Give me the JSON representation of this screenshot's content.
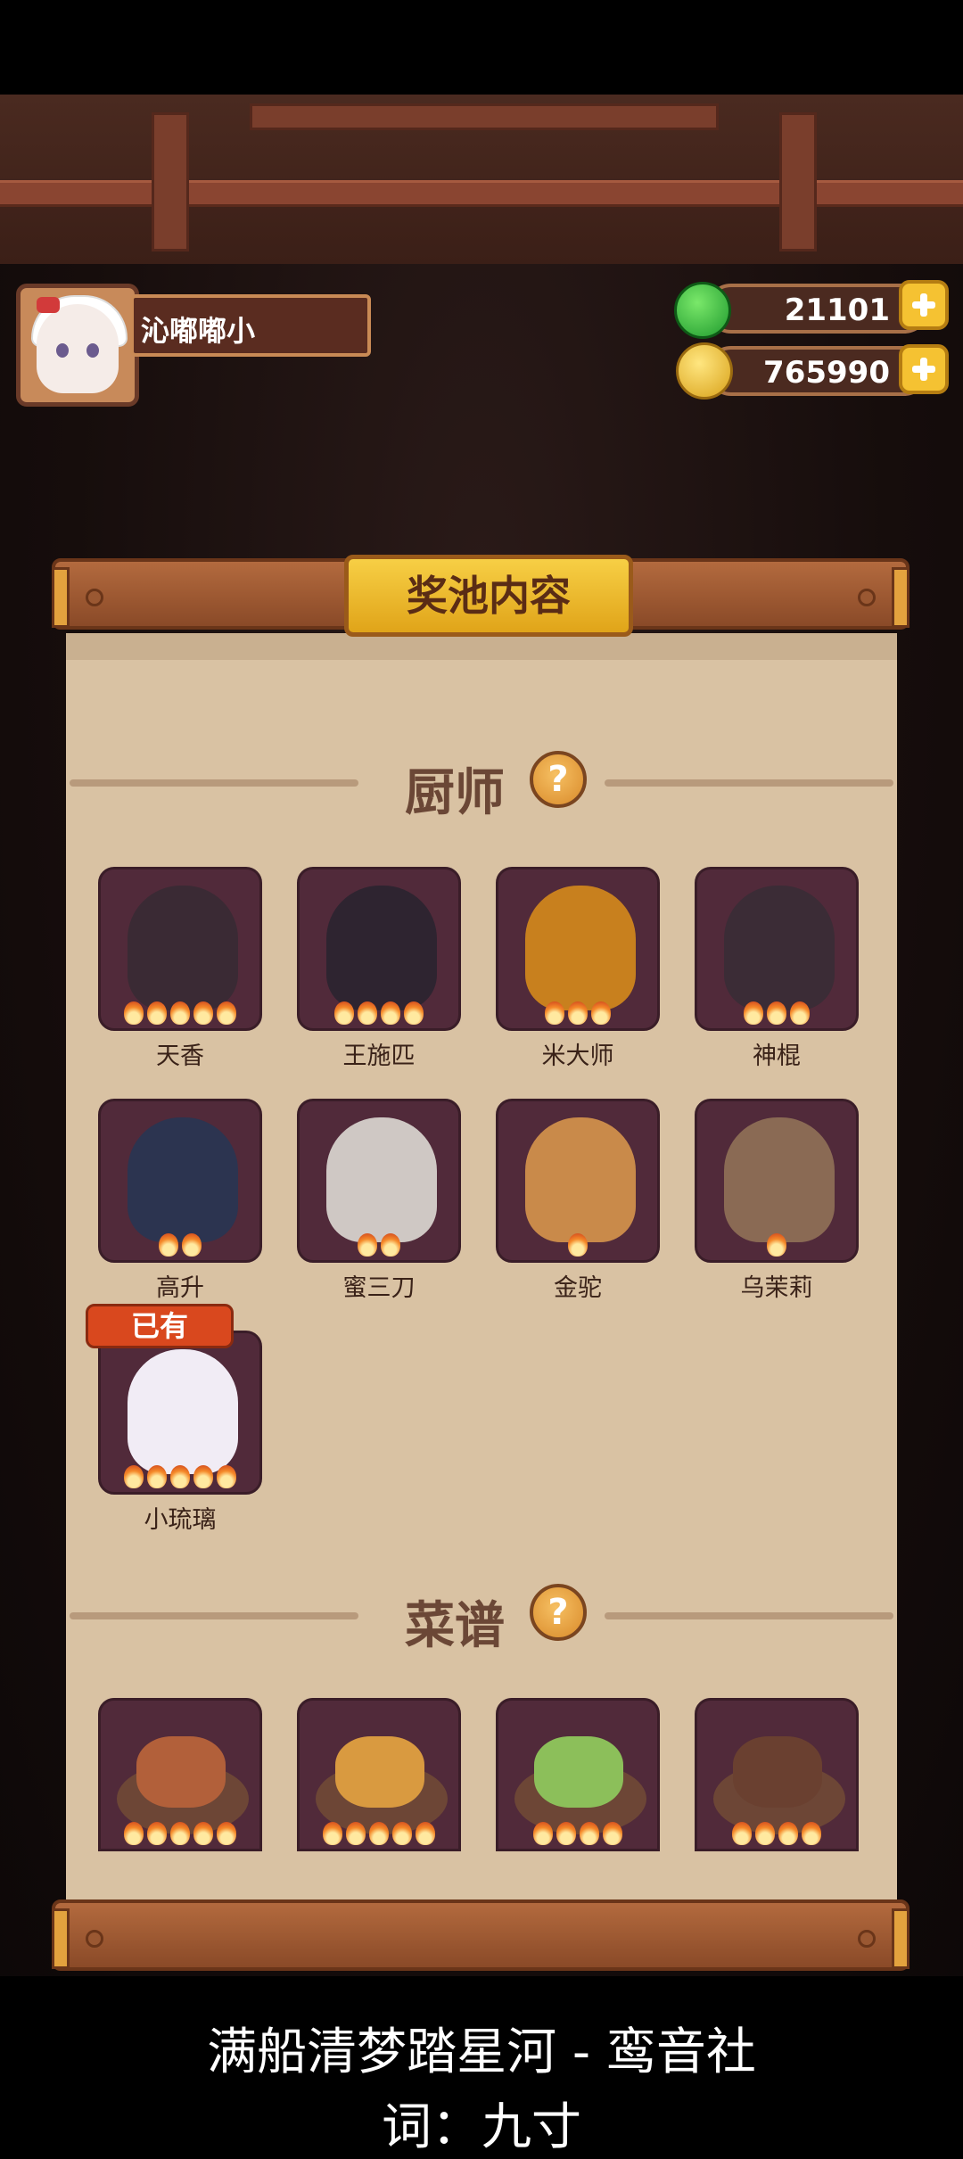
{
  "player": {
    "name": "沁嘟嘟小"
  },
  "currency": {
    "jade": "21101",
    "coins": "765990"
  },
  "panel": {
    "title": "奖池内容"
  },
  "chef_section": {
    "label": "厨师",
    "help": "?",
    "owned_badge": "已有",
    "chefs": [
      {
        "name": "天香",
        "stars": 5,
        "color": "#3a2a34"
      },
      {
        "name": "王施匹",
        "stars": 4,
        "color": "#2e2430"
      },
      {
        "name": "米大师",
        "stars": 3,
        "color": "#c8801e"
      },
      {
        "name": "神棍",
        "stars": 3,
        "color": "#3b2c36"
      },
      {
        "name": "高升",
        "stars": 2,
        "color": "#2c3450"
      },
      {
        "name": "蜜三刀",
        "stars": 2,
        "color": "#cfc8c4"
      },
      {
        "name": "金驼",
        "stars": 1,
        "color": "#c98a4a"
      },
      {
        "name": "乌茉莉",
        "stars": 1,
        "color": "#8a6a54"
      },
      {
        "name": "小琉璃",
        "stars": 5,
        "color": "#f1ecf5"
      }
    ]
  },
  "recipe_section": {
    "label": "菜谱",
    "help": "?",
    "dishes": [
      {
        "stars": 5,
        "color": "#b2603a"
      },
      {
        "stars": 5,
        "color": "#d99a40"
      },
      {
        "stars": 4,
        "color": "#8cbf5a"
      },
      {
        "stars": 4,
        "color": "#6a4030"
      }
    ]
  },
  "captions": {
    "line1": "满船清梦踏星河 - 鸾音社",
    "line2": "词：九寸"
  }
}
